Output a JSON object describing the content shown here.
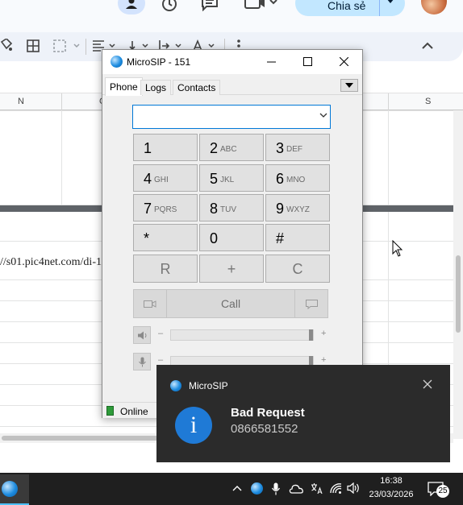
{
  "sheets": {
    "share_label": "Chia sẻ",
    "columns": [
      "N",
      "C",
      "S"
    ],
    "cell_text": "//s01.pic4net.com/di-1"
  },
  "microsip": {
    "window_title": "MicroSIP - 151",
    "tabs": [
      {
        "label": "Phone",
        "active": true
      },
      {
        "label": "Logs",
        "active": false
      },
      {
        "label": "Contacts",
        "active": false
      }
    ],
    "dial_value": "",
    "keys": [
      {
        "digit": "1",
        "letters": ""
      },
      {
        "digit": "2",
        "letters": "ABC"
      },
      {
        "digit": "3",
        "letters": "DEF"
      },
      {
        "digit": "4",
        "letters": "GHI"
      },
      {
        "digit": "5",
        "letters": "JKL"
      },
      {
        "digit": "6",
        "letters": "MNO"
      },
      {
        "digit": "7",
        "letters": "PQRS"
      },
      {
        "digit": "8",
        "letters": "TUV"
      },
      {
        "digit": "9",
        "letters": "WXYZ"
      },
      {
        "digit": "*",
        "letters": ""
      },
      {
        "digit": "0",
        "letters": ""
      },
      {
        "digit": "#",
        "letters": ""
      }
    ],
    "controls": {
      "redial": "R",
      "plus": "+",
      "clear": "C"
    },
    "call_label": "Call",
    "volume": {
      "minus": "–",
      "plus": "+",
      "speaker_level": 0.98,
      "mic_level": 0.98
    },
    "status": "Online"
  },
  "toast": {
    "app": "MicroSIP",
    "title": "Bad Request",
    "body": "0866581552",
    "icon_glyph": "i"
  },
  "taskbar": {
    "time": "16:38",
    "date": "23/03/2026",
    "notifications": "25"
  }
}
